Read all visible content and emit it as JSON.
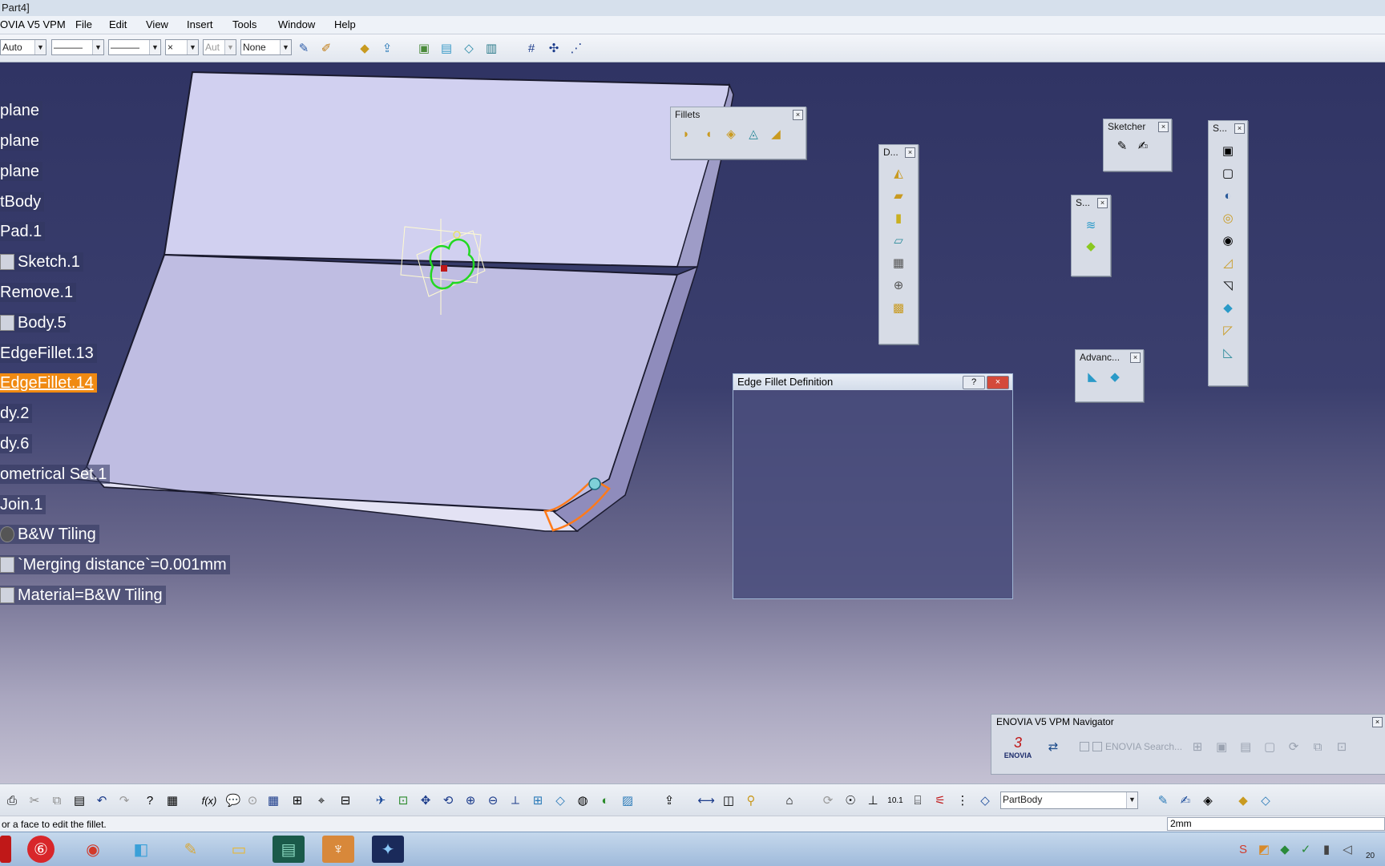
{
  "window": {
    "title": "Part4]"
  },
  "menubar": {
    "app_label": "OVIA V5 VPM",
    "items": [
      {
        "label": "File",
        "key": "F"
      },
      {
        "label": "Edit",
        "key": "E"
      },
      {
        "label": "View",
        "key": "V"
      },
      {
        "label": "Insert",
        "key": "I"
      },
      {
        "label": "Tools",
        "key": "T"
      },
      {
        "label": "Window",
        "key": "W"
      },
      {
        "label": "Help",
        "key": "H"
      }
    ]
  },
  "toolbar": {
    "color_combo": "Auto",
    "linetype_combo": "———",
    "lineweight_combo": "———",
    "point_combo": "×",
    "layer_combo": "Aut",
    "filter_combo": "None"
  },
  "tree": {
    "items": [
      {
        "label": "plane",
        "selected": false
      },
      {
        "label": "plane",
        "selected": false
      },
      {
        "label": "plane",
        "selected": false
      },
      {
        "label": "tBody",
        "selected": false
      },
      {
        "label": "Pad.1",
        "selected": false
      },
      {
        "label": "Sketch.1",
        "selected": false,
        "icon": "sketch-icon"
      },
      {
        "label": "Remove.1",
        "selected": false
      },
      {
        "label": "Body.5",
        "selected": false,
        "icon": "body-icon"
      },
      {
        "label": "EdgeFillet.13",
        "selected": false
      },
      {
        "label": "EdgeFillet.14",
        "selected": true
      },
      {
        "label": "dy.2",
        "selected": false
      },
      {
        "label": "dy.6",
        "selected": false
      },
      {
        "label": "ometrical Set.1",
        "selected": false
      },
      {
        "label": "Join.1",
        "selected": false
      },
      {
        "label": "B&W Tiling",
        "selected": false,
        "icon": "material-icon"
      },
      {
        "label": "`Merging distance`=0.001mm",
        "selected": false,
        "icon": "parameter-icon"
      },
      {
        "label": "Material=B&W Tiling",
        "selected": false,
        "icon": "parameter-icon"
      }
    ]
  },
  "palettes": {
    "fillets": {
      "title": "Fillets"
    },
    "dress": {
      "title": "D..."
    },
    "sketcher": {
      "title": "Sketcher"
    },
    "surface": {
      "title": "S..."
    },
    "advanced": {
      "title": "Advanc..."
    },
    "sketch_based": {
      "title": "S..."
    }
  },
  "dialog": {
    "title": "Edge Fillet Definition",
    "help_label": "?",
    "close_label": "×"
  },
  "navigator": {
    "title": "ENOVIA V5 VPM Navigator",
    "logo_text": "ENOVIA",
    "search_label": "ENOVIA Search..."
  },
  "bottom_toolbar": {
    "current_body": "PartBody"
  },
  "status": {
    "message": "or a face to edit the fillet.",
    "value_field": "2mm"
  },
  "taskbar": {
    "clock": "20"
  }
}
